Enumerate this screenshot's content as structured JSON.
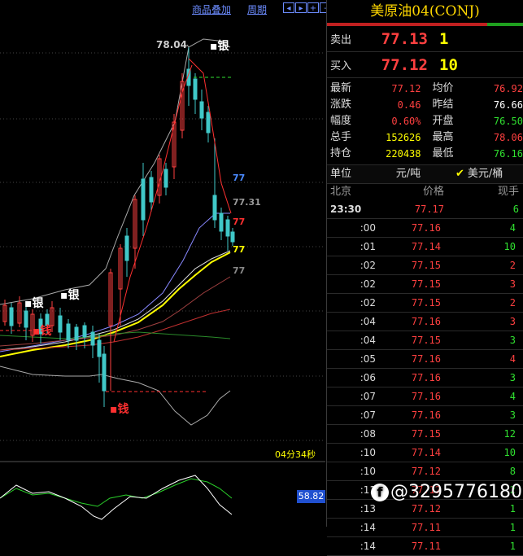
{
  "toolbar": {
    "overlay_label": "商品叠加",
    "period_label": "周期"
  },
  "chart": {
    "high_label": "78.04",
    "label_77_blue": "77",
    "label_7731": "77.31",
    "label_77_red": "77",
    "label_77_yellow": "77",
    "label_77_grey": "77",
    "silver_marks": [
      "银",
      "银",
      "银"
    ],
    "money_marks": [
      "钱",
      "钱"
    ],
    "countdown": "04分34秒",
    "osc_value": "58.82"
  },
  "quote": {
    "title": "美原油04(CONJ)",
    "sell_label": "卖出",
    "sell_price": "77.13",
    "sell_vol": "1",
    "buy_label": "买入",
    "buy_price": "77.12",
    "buy_vol": "10"
  },
  "stats": [
    {
      "l": "最新",
      "v": "77.12",
      "vc": "red",
      "l2": "均价",
      "v2": "76.92",
      "v2c": "red"
    },
    {
      "l": "涨跌",
      "v": "0.46",
      "vc": "red",
      "l2": "昨结",
      "v2": "76.66",
      "v2c": "wht"
    },
    {
      "l": "幅度",
      "v": "0.60%",
      "vc": "red",
      "l2": "开盘",
      "v2": "76.50",
      "v2c": "grn"
    },
    {
      "l": "总手",
      "v": "152626",
      "vc": "yel",
      "l2": "最高",
      "v2": "78.06",
      "v2c": "red"
    },
    {
      "l": "持仓",
      "v": "220438",
      "vc": "yel",
      "l2": "最低",
      "v2": "76.16",
      "v2c": "grn"
    }
  ],
  "unit": {
    "label": "单位",
    "opt1": "元/吨",
    "check": "✔",
    "opt2": "美元/桶"
  },
  "ticks_header": {
    "time": "北京",
    "price": "价格",
    "vol": "现手"
  },
  "ticks": [
    {
      "t": "23:30",
      "p": "77.17",
      "v": "6",
      "vc": "grn"
    },
    {
      "t": ":00",
      "p": "77.16",
      "v": "4",
      "vc": "grn"
    },
    {
      "t": ":01",
      "p": "77.14",
      "v": "10",
      "vc": "grn"
    },
    {
      "t": ":02",
      "p": "77.15",
      "v": "2",
      "vc": "red"
    },
    {
      "t": ":02",
      "p": "77.15",
      "v": "3",
      "vc": "red"
    },
    {
      "t": ":02",
      "p": "77.15",
      "v": "2",
      "vc": "red"
    },
    {
      "t": ":04",
      "p": "77.16",
      "v": "3",
      "vc": "red"
    },
    {
      "t": ":04",
      "p": "77.15",
      "v": "3",
      "vc": "grn"
    },
    {
      "t": ":05",
      "p": "77.16",
      "v": "4",
      "vc": "red"
    },
    {
      "t": ":06",
      "p": "77.16",
      "v": "3",
      "vc": "grn"
    },
    {
      "t": ":07",
      "p": "77.16",
      "v": "4",
      "vc": "grn"
    },
    {
      "t": ":07",
      "p": "77.16",
      "v": "3",
      "vc": "grn"
    },
    {
      "t": ":08",
      "p": "77.15",
      "v": "12",
      "vc": "grn"
    },
    {
      "t": ":10",
      "p": "77.14",
      "v": "10",
      "vc": "grn"
    },
    {
      "t": ":10",
      "p": "77.12",
      "v": "8",
      "vc": "grn"
    },
    {
      "t": ":11",
      "p": "77.12",
      "v": "2",
      "vc": "grn"
    },
    {
      "t": ":13",
      "p": "77.12",
      "v": "1",
      "vc": "grn"
    },
    {
      "t": ":14",
      "p": "77.11",
      "v": "1",
      "vc": "grn"
    },
    {
      "t": ":14",
      "p": "77.11",
      "v": "1",
      "vc": "grn"
    }
  ],
  "watermark": {
    "logo": "f",
    "text": "@3295776180"
  }
}
